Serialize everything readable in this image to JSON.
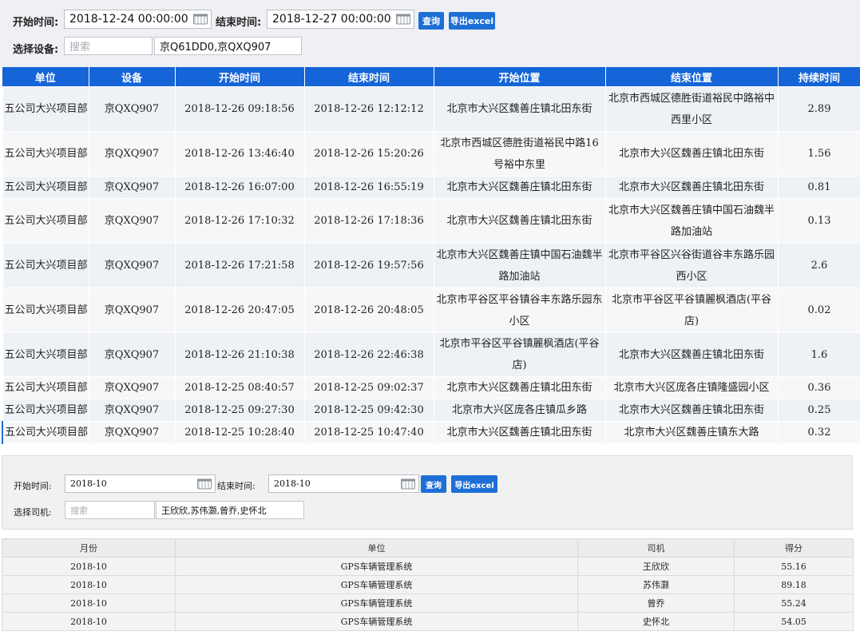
{
  "top_filters": {
    "start_label": "开始时间:",
    "start_value": "2018-12-24 00:00:00",
    "end_label": "结束时间:",
    "end_value": "2018-12-27 00:00:00",
    "query_label": "查询",
    "export_label": "导出excel",
    "device_label": "选择设备:",
    "search_placeholder": "搜索",
    "selected_devices": "京Q61DD0,京QXQ907"
  },
  "trip_table": {
    "headers": [
      "单位",
      "设备",
      "开始时间",
      "结束时间",
      "开始位置",
      "结束位置",
      "持续时间"
    ],
    "rows": [
      {
        "unit": "五公司大兴项目部",
        "device": "京QXQ907",
        "start": "2018-12-26 09:18:56",
        "end": "2018-12-26 12:12:12",
        "from": "北京市大兴区魏善庄镇北田东街",
        "to": "北京市西城区德胜街道裕民中路裕中西里小区",
        "duration": "2.89"
      },
      {
        "unit": "五公司大兴项目部",
        "device": "京QXQ907",
        "start": "2018-12-26 13:46:40",
        "end": "2018-12-26 15:20:26",
        "from": "北京市西城区德胜街道裕民中路16号裕中东里",
        "to": "北京市大兴区魏善庄镇北田东街",
        "duration": "1.56"
      },
      {
        "unit": "五公司大兴项目部",
        "device": "京QXQ907",
        "start": "2018-12-26 16:07:00",
        "end": "2018-12-26 16:55:19",
        "from": "北京市大兴区魏善庄镇北田东街",
        "to": "北京市大兴区魏善庄镇北田东街",
        "duration": "0.81"
      },
      {
        "unit": "五公司大兴项目部",
        "device": "京QXQ907",
        "start": "2018-12-26 17:10:32",
        "end": "2018-12-26 17:18:36",
        "from": "北京市大兴区魏善庄镇北田东街",
        "to": "北京市大兴区魏善庄镇中国石油魏半路加油站",
        "duration": "0.13"
      },
      {
        "unit": "五公司大兴项目部",
        "device": "京QXQ907",
        "start": "2018-12-26 17:21:58",
        "end": "2018-12-26 19:57:56",
        "from": "北京市大兴区魏善庄镇中国石油魏半路加油站",
        "to": "北京市平谷区兴谷街道谷丰东路乐园西小区",
        "duration": "2.6"
      },
      {
        "unit": "五公司大兴项目部",
        "device": "京QXQ907",
        "start": "2018-12-26 20:47:05",
        "end": "2018-12-26 20:48:05",
        "from": "北京市平谷区平谷镇谷丰东路乐园东小区",
        "to": "北京市平谷区平谷镇麗枫酒店(平谷店)",
        "duration": "0.02"
      },
      {
        "unit": "五公司大兴项目部",
        "device": "京QXQ907",
        "start": "2018-12-26 21:10:38",
        "end": "2018-12-26 22:46:38",
        "from": "北京市平谷区平谷镇麗枫酒店(平谷店)",
        "to": "北京市大兴区魏善庄镇北田东街",
        "duration": "1.6"
      },
      {
        "unit": "五公司大兴项目部",
        "device": "京QXQ907",
        "start": "2018-12-25 08:40:57",
        "end": "2018-12-25 09:02:37",
        "from": "北京市大兴区魏善庄镇北田东街",
        "to": "北京市大兴区庞各庄镇隆盛园小区",
        "duration": "0.36"
      },
      {
        "unit": "五公司大兴项目部",
        "device": "京QXQ907",
        "start": "2018-12-25 09:27:30",
        "end": "2018-12-25 09:42:30",
        "from": "北京市大兴区庞各庄镇瓜乡路",
        "to": "北京市大兴区魏善庄镇北田东街",
        "duration": "0.25"
      },
      {
        "unit": "五公司大兴项目部",
        "device": "京QXQ907",
        "start": "2018-12-25 10:28:40",
        "end": "2018-12-25 10:47:40",
        "from": "北京市大兴区魏善庄镇北田东街",
        "to": "北京市大兴区魏善庄镇东大路",
        "duration": "0.32"
      }
    ]
  },
  "bottom_filters": {
    "start_label": "开始时间:",
    "start_value": "2018-10",
    "end_label": "结束时间:",
    "end_value": "2018-10",
    "query_label": "查询",
    "export_label": "导出excel",
    "driver_label": "选择司机:",
    "search_placeholder": "搜索",
    "selected_drivers": "王欣欣,苏伟灏,曾乔,史怀北"
  },
  "score_table": {
    "headers": [
      "月份",
      "单位",
      "司机",
      "得分"
    ],
    "rows": [
      {
        "month": "2018-10",
        "unit": "GPS车辆管理系统",
        "driver": "王欣欣",
        "score": "55.16"
      },
      {
        "month": "2018-10",
        "unit": "GPS车辆管理系统",
        "driver": "苏伟灏",
        "score": "89.18"
      },
      {
        "month": "2018-10",
        "unit": "GPS车辆管理系统",
        "driver": "曾乔",
        "score": "55.24"
      },
      {
        "month": "2018-10",
        "unit": "GPS车辆管理系统",
        "driver": "史怀北",
        "score": "54.05"
      }
    ]
  }
}
